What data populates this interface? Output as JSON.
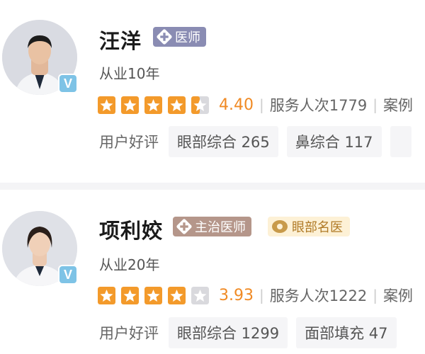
{
  "doctors": [
    {
      "name": "汪洋",
      "title_tag": "医师",
      "years": "从业10年",
      "rating": 4.4,
      "score": "4.40",
      "service_label": "服务人次1779",
      "case_label": "案例",
      "review_label": "用户好评",
      "chips": [
        "眼部综合 265",
        "鼻综合 117"
      ],
      "verified_badge": "V"
    },
    {
      "name": "项利姣",
      "title_tag": "主治医师",
      "extra_tag": "眼部名医",
      "years": "从业20年",
      "rating": 3.93,
      "score": "3.93",
      "service_label": "服务人次1222",
      "case_label": "案例",
      "review_label": "用户好评",
      "chips": [
        "眼部综合 1299",
        "面部填充 47"
      ],
      "verified_badge": "V"
    }
  ],
  "colors": {
    "star": "#f39a2b",
    "star_empty": "#d9d9dd",
    "score": "#f08a24",
    "tag_doctor": "#8a8cb3",
    "tag_attending": "#b5968a",
    "tag_famous_bg": "#fdf1d6"
  },
  "icons": {
    "title_tag": "medical-cross-icon",
    "famous_tag": "eye-icon",
    "rating": "star-icon"
  }
}
